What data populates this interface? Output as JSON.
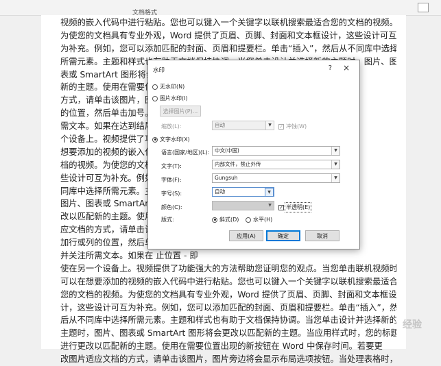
{
  "ribbon": {
    "label": "文档格式"
  },
  "document": {
    "lines": [
      "视频的嵌入代码中进行粘贴。您也可以键入一个关键字以联机搜索最适合您的文档的视频。",
      "为使您的文档具有专业外观，Word 提供了页眉、页脚、封面和文本框设计，这些设计可互",
      "为补充。例如，您可以添加匹配的封面、页眉和提要栏。单击“插入”，然后从不同库中选择",
      "所需元素。主题和样式也有助于文档保持协调。当您单击设计并选择新的主题时，图片、图",
      "表或 SmartArt 图形将会                                                              更改以匹配",
      "新的主题。使用在需要位                                                              片适应文档的",
      "方式，请单击该图片，图                                                              要添加行或列",
      "的位置，然后单击加号。                                                              部分并关注所",
      "需文本。如果在达到结尾                                                              ，即使在另一",
      "个设备上。视频提供了功                                                              视频时，可以在",
      "想要添加的视频的嵌入代                                                              最适合您的文",
      "档的视频。为使您的文档                                                              本框设计，这",
      "些设计可互为补充。例如                                                              ”，然后从不",
      "同库中选择所需元素。主                                                              新的主题时，",
      "图片、图表或 SmartArt                                                               标题会进行更",
      "改以匹配新的主题。使用                                                              单击图片适",
      "应文档的方式，请单击该                                                              时，单击要添",
      "加行或列的位置，然后单                                                              文档某些部分",
      "并关注所需文本。如果在                                                              止位置 - 即",
      "使在另一个设备上。视频提供了功能强大的方法帮助您证明您的观点。当您单击联机视频时，",
      "可以在想要添加的视频的嵌入代码中进行粘贴。您也可以键入一个关键字以联机搜索最适合",
      "您的文档的视频。为使您的文档具有专业外观，Word 提供了页眉、页脚、封面和文本框设",
      "计，这些设计可互为补充。例如，您可以添加匹配的封面、页眉和提要栏。单击“插入”，然",
      "后从不同库中选择所需元素。主题和样式也有助于文档保持协调。当您单击设计并选择新的",
      "主题时，图片、图表或 SmartArt 图形将会更改以匹配新的主题。当应用样式时，您的标题会",
      "进行更改以匹配新的主题。使用在需要位置出现的新按钮在 Word 中保存时间。若要更",
      "改图片适应文档的方式，请单击该图片，图片旁边将会显示布局选项按钮。当处理表格时，"
    ],
    "watermark": "经验"
  },
  "dialog": {
    "title": "水印",
    "help_label": "?",
    "close_label": "×",
    "no_watermark": "无水印(N)",
    "picture_watermark": "图片水印(I)",
    "select_picture": "选择图片(P)...",
    "scale_label": "缩放(L):",
    "scale_value": "自动",
    "washout_label": "冲蚀(W)",
    "text_watermark": "文字水印(X)",
    "language_label": "语言(国家/地区)(L):",
    "language_value": "中文(中国)",
    "text_label": "文字(T):",
    "text_value": "内部文件，禁止外传",
    "font_label": "字体(F):",
    "font_value": "Gungsuh",
    "size_label": "字号(S):",
    "size_value": "自动",
    "color_label": "颜色(C):",
    "semi_transparent": "半透明(E)",
    "layout_label": "版式:",
    "diagonal": "斜式(D)",
    "horizontal": "水平(H)",
    "apply_button": "应用(A)",
    "ok_button": "确定",
    "cancel_button": "取消",
    "selected_mode": "text"
  }
}
